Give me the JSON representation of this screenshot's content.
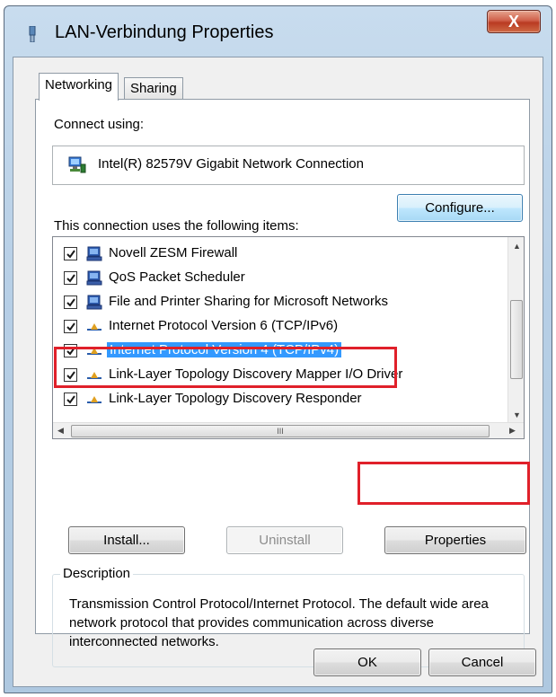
{
  "window": {
    "title": "LAN-Verbindung Properties",
    "close_label": "X"
  },
  "tabs": [
    {
      "label": "Networking",
      "active": true
    },
    {
      "label": "Sharing",
      "active": false
    }
  ],
  "connect_using": {
    "label": "Connect using:",
    "adapter_name": "Intel(R) 82579V Gigabit Network Connection",
    "configure_label": "Configure..."
  },
  "items": {
    "label": "This connection uses the following items:",
    "list": [
      {
        "label": "Novell ZESM Firewall",
        "checked": true,
        "icon": "network-client-icon"
      },
      {
        "label": "QoS Packet Scheduler",
        "checked": true,
        "icon": "network-client-icon"
      },
      {
        "label": "File and Printer Sharing for Microsoft Networks",
        "checked": true,
        "icon": "network-client-icon"
      },
      {
        "label": "Internet Protocol Version 6 (TCP/IPv6)",
        "checked": true,
        "icon": "protocol-icon"
      },
      {
        "label": "Internet Protocol Version 4 (TCP/IPv4)",
        "checked": true,
        "icon": "protocol-icon",
        "selected": true
      },
      {
        "label": "Link-Layer Topology Discovery Mapper I/O Driver",
        "checked": true,
        "icon": "protocol-icon"
      },
      {
        "label": "Link-Layer Topology Discovery Responder",
        "checked": true,
        "icon": "protocol-icon"
      }
    ],
    "hscroll_grip": "III"
  },
  "buttons": {
    "install": "Install...",
    "uninstall": "Uninstall",
    "properties": "Properties",
    "ok": "OK",
    "cancel": "Cancel"
  },
  "description": {
    "title": "Description",
    "text": "Transmission Control Protocol/Internet Protocol. The default wide area network protocol that provides communication across diverse interconnected networks."
  },
  "colors": {
    "selection": "#3399ff",
    "highlight_box": "#e0202a"
  }
}
